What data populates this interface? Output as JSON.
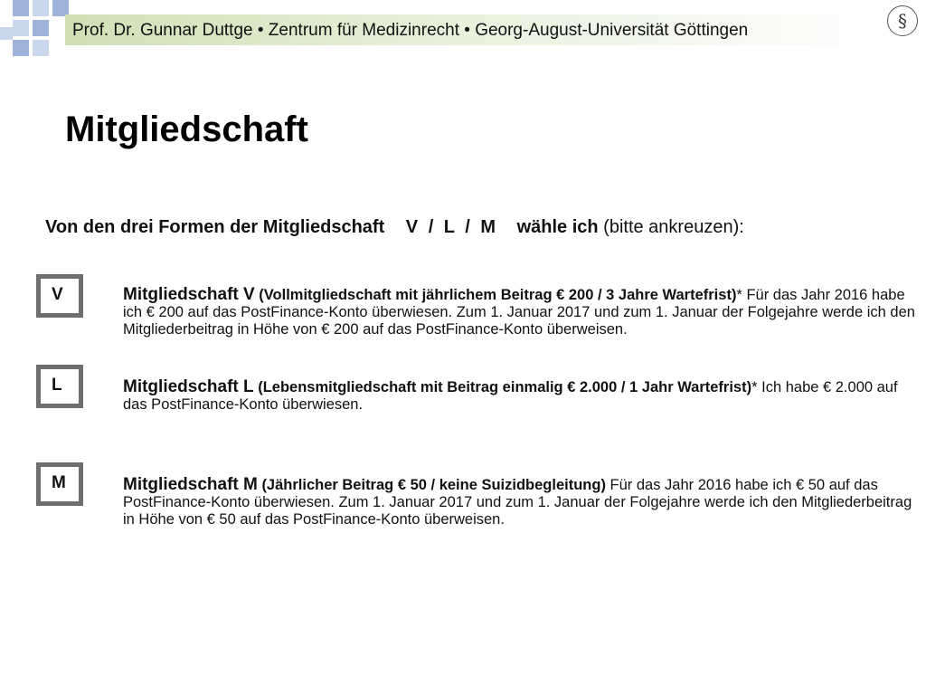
{
  "header": {
    "text": "Prof. Dr. Gunnar Duttge • Zentrum für Medizinrecht • Georg-August-Universität Göttingen",
    "logo_glyph": "§",
    "band_color": "#cfe0b5",
    "square_colors": [
      "#9fb2d9",
      "#c9d6ec"
    ]
  },
  "page_title": "Mitgliedschaft",
  "form": {
    "prompt_start": "Von den drei Formen der Mitgliedschaft",
    "prompt_letters": "V / L / M",
    "prompt_mid": "wähle ich",
    "prompt_end": "(bitte ankreuzen):",
    "options": [
      {
        "letter": "V",
        "title": "Mitgliedschaft V",
        "subtitle": "(Vollmitgliedschaft mit jährlichem Beitrag € 200 / 3 Jahre Wartefrist)",
        "text": "* Für das Jahr 2016 habe ich € 200 auf das PostFinance-Konto überwiesen. Zum 1. Januar 2017 und zum 1. Januar der Folgejahre werde ich den Mitgliederbeitrag in Höhe von € 200 auf das PostFinance-Konto überweisen."
      },
      {
        "letter": "L",
        "title": "Mitgliedschaft L",
        "subtitle": "(Lebensmitgliedschaft mit Beitrag einmalig € 2.000 / 1 Jahr Wartefrist)",
        "text": "* Ich habe € 2.000 auf das PostFinance-Konto überwiesen."
      },
      {
        "letter": "M",
        "title": "Mitgliedschaft M",
        "subtitle": "(Jährlicher Beitrag € 50 / keine Suizidbegleitung)",
        "text": " Für das Jahr 2016 habe ich € 50 auf das PostFinance-Konto überwiesen. Zum 1. Januar 2017 und zum 1. Januar der Folgejahre werde ich den Mitgliederbeitrag in Höhe von € 50 auf das PostFinance-Konto überweisen."
      }
    ]
  }
}
